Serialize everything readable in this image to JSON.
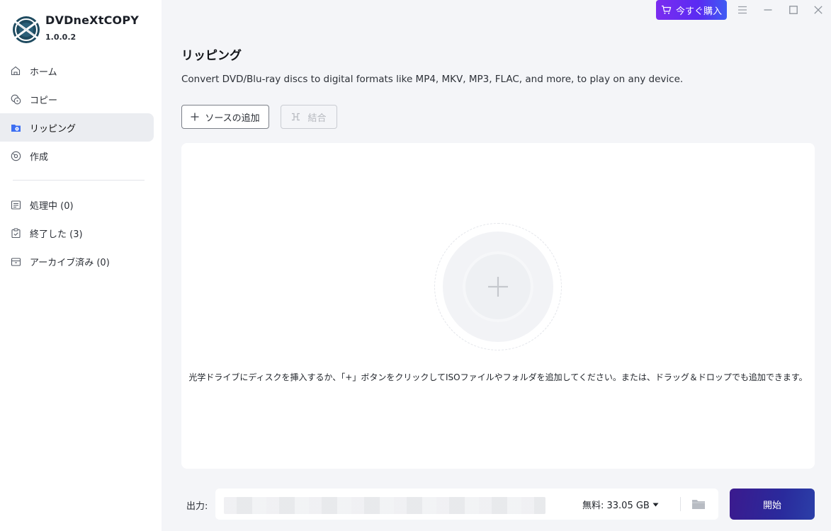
{
  "app": {
    "name": "DVDneXtCOPY",
    "version": "1.0.0.2"
  },
  "topbar": {
    "buy_label": "今すぐ購入"
  },
  "sidebar": {
    "items": [
      {
        "label": "ホーム",
        "icon": "home-icon"
      },
      {
        "label": "コピー",
        "icon": "copy-icon"
      },
      {
        "label": "リッピング",
        "icon": "ripping-icon",
        "active": true
      },
      {
        "label": "作成",
        "icon": "create-icon"
      }
    ],
    "queue": [
      {
        "label": "処理中 (0)",
        "icon": "processing-icon"
      },
      {
        "label": "終了した (3)",
        "icon": "finished-icon"
      },
      {
        "label": "アーカイブ済み (0)",
        "icon": "archive-icon"
      }
    ]
  },
  "main": {
    "title": "リッピング",
    "description": "Convert DVD/Blu-ray discs to digital formats like MP4, MKV, MP3, FLAC, and more, to play on any device.",
    "add_source_label": "ソースの追加",
    "merge_label": "結合",
    "drop_hint": "光学ドライブにディスクを挿入するか、「+」ボタンをクリックしてISOファイルやフォルダを追加してください。または、ドラッグ＆ドロップでも追加できます。"
  },
  "output": {
    "label": "出力:",
    "free_space": "無料: 33.05 GB",
    "start_label": "開始"
  },
  "colors": {
    "buy_gradient_start": "#7b2cf0",
    "buy_gradient_end": "#3f5cf3",
    "start_gradient_start": "#3b1a8e",
    "start_gradient_end": "#2b3fa8",
    "active_nav_bg": "#ebedf1",
    "accent_blue": "#3d6ff2"
  }
}
